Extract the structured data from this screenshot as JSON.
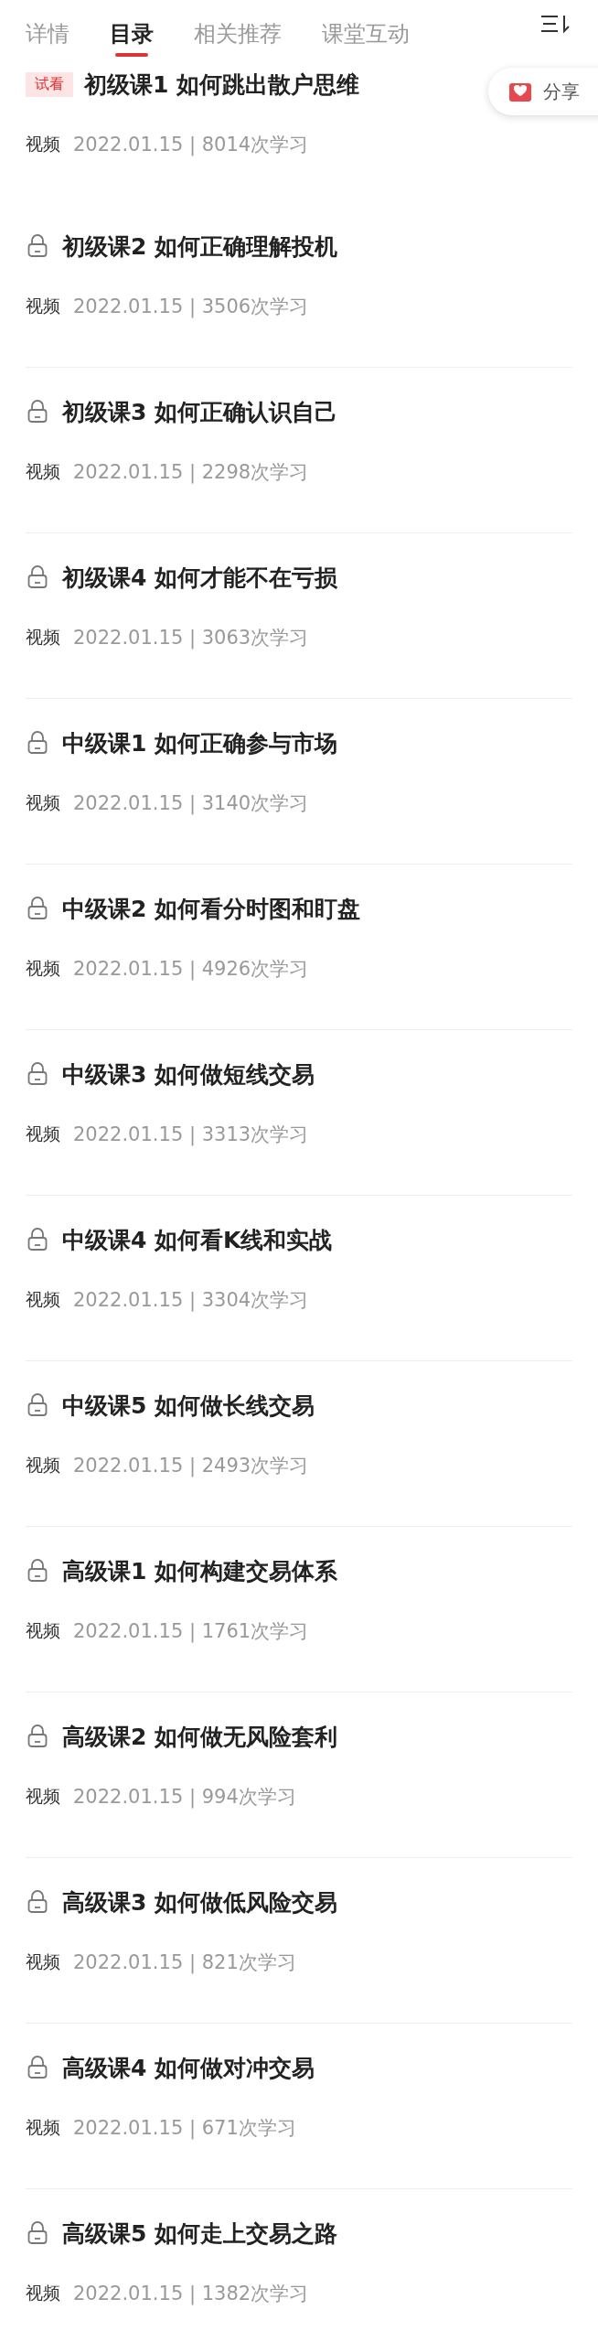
{
  "tabs": [
    {
      "label": "详情",
      "selected": false
    },
    {
      "label": "目录",
      "selected": true
    },
    {
      "label": "相关推荐",
      "selected": false
    },
    {
      "label": "课堂互动",
      "selected": false
    }
  ],
  "share": {
    "label": "分享"
  },
  "lessons": [
    {
      "badge": "试看",
      "locked": false,
      "title": "初级课1 如何跳出散户思维",
      "type": "视频",
      "meta": "2022.01.15 | 8014次学习"
    },
    {
      "locked": true,
      "title": "初级课2 如何正确理解投机",
      "type": "视频",
      "meta": "2022.01.15 | 3506次学习"
    },
    {
      "locked": true,
      "title": "初级课3 如何正确认识自己",
      "type": "视频",
      "meta": "2022.01.15 | 2298次学习"
    },
    {
      "locked": true,
      "title": "初级课4 如何才能不在亏损",
      "type": "视频",
      "meta": "2022.01.15 | 3063次学习"
    },
    {
      "locked": true,
      "title": "中级课1 如何正确参与市场",
      "type": "视频",
      "meta": "2022.01.15 | 3140次学习"
    },
    {
      "locked": true,
      "title": "中级课2 如何看分时图和盯盘",
      "type": "视频",
      "meta": "2022.01.15 | 4926次学习"
    },
    {
      "locked": true,
      "title": "中级课3 如何做短线交易",
      "type": "视频",
      "meta": "2022.01.15 | 3313次学习"
    },
    {
      "locked": true,
      "title": "中级课4 如何看K线和实战",
      "type": "视频",
      "meta": "2022.01.15 | 3304次学习"
    },
    {
      "locked": true,
      "title": "中级课5 如何做长线交易",
      "type": "视频",
      "meta": "2022.01.15 | 2493次学习"
    },
    {
      "locked": true,
      "title": "高级课1 如何构建交易体系",
      "type": "视频",
      "meta": "2022.01.15 | 1761次学习"
    },
    {
      "locked": true,
      "title": "高级课2 如何做无风险套利",
      "type": "视频",
      "meta": "2022.01.15 | 994次学习"
    },
    {
      "locked": true,
      "title": "高级课3 如何做低风险交易",
      "type": "视频",
      "meta": "2022.01.15 | 821次学习"
    },
    {
      "locked": true,
      "title": "高级课4 如何做对冲交易",
      "type": "视频",
      "meta": "2022.01.15 | 671次学习"
    },
    {
      "locked": true,
      "title": "高级课5 如何走上交易之路",
      "type": "视频",
      "meta": "2022.01.15 | 1382次学习"
    }
  ]
}
